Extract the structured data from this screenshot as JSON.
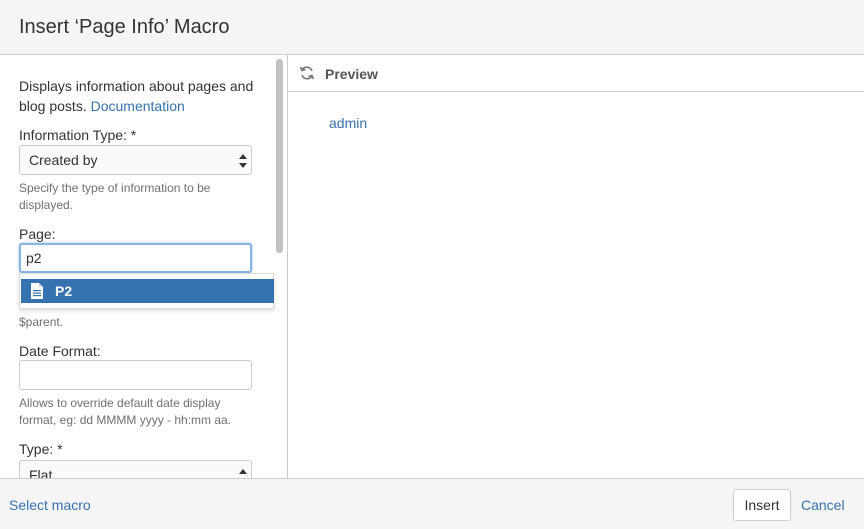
{
  "dialog": {
    "title": "Insert ‘Page Info’ Macro"
  },
  "left": {
    "description": "Displays information about pages and blog posts.",
    "documentation_link": "Documentation",
    "info_type": {
      "label": "Information Type: *",
      "value": "Created by",
      "help": "Specify the type of information to be displayed."
    },
    "page": {
      "label": "Page:",
      "value": "p2",
      "help_tail": "$parent.",
      "suggestion": "P2"
    },
    "date_format": {
      "label": "Date Format:",
      "value": "",
      "help": "Allows to override default date display format, eg: dd MMMM yyyy - hh:mm aa."
    },
    "type": {
      "label": "Type: *",
      "value": "Flat"
    }
  },
  "preview": {
    "label": "Preview",
    "content": "admin"
  },
  "footer": {
    "select_macro": "Select macro",
    "insert": "Insert",
    "cancel": "Cancel"
  },
  "colors": {
    "link": "#3572b0",
    "selected": "#3572b0",
    "focus": "#8ab4e6"
  }
}
